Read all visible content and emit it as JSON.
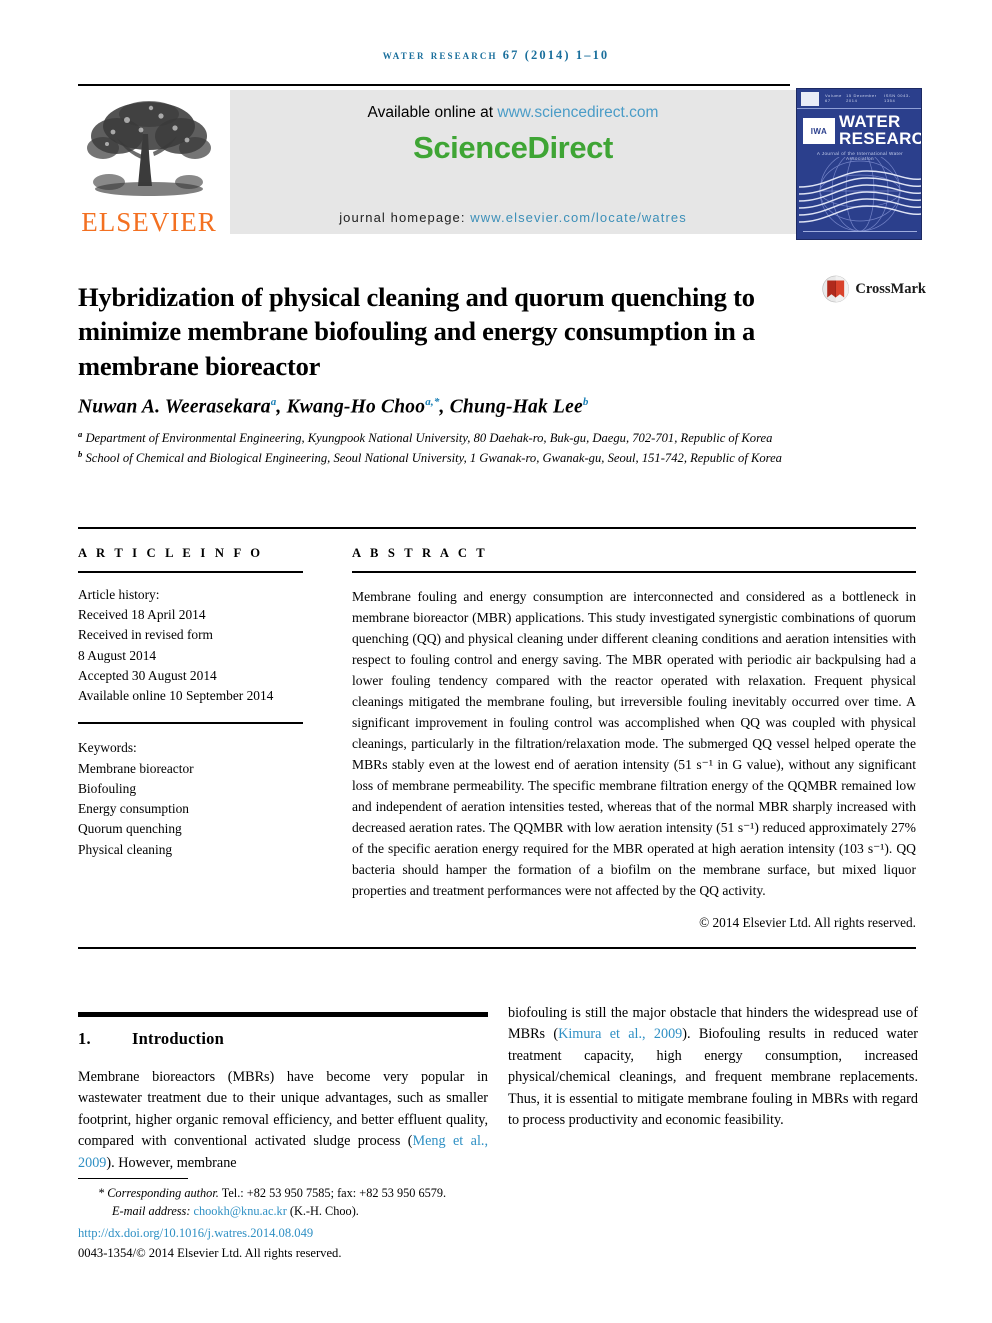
{
  "running_head": "water research 67 (2014) 1–10",
  "masthead": {
    "publisher_name": "ELSEVIER",
    "available_text": "Available online at ",
    "sciencedirect_url": "www.sciencedirect.com",
    "brand": "ScienceDirect",
    "homepage_label": "journal homepage: ",
    "homepage_url": "www.elsevier.com/locate/watres",
    "cover": {
      "volume": "Volume 67",
      "date": "15 December 2014",
      "issn": "ISSN 0043-1354",
      "society": "IWA",
      "title_line1": "WATER",
      "title_line2": "RESEARCH",
      "subtitle": "A Journal of the International Water Association"
    }
  },
  "crossmark": {
    "label": "CrossMark"
  },
  "article": {
    "title": "Hybridization of physical cleaning and quorum quenching to minimize membrane biofouling and energy consumption in a membrane bioreactor",
    "authors": [
      {
        "name": "Nuwan A. Weerasekara",
        "marks": "a"
      },
      {
        "name": "Kwang-Ho Choo",
        "marks": "a,*"
      },
      {
        "name": "Chung-Hak Lee",
        "marks": "b"
      }
    ],
    "affiliations": [
      {
        "mark": "a",
        "text": "Department of Environmental Engineering, Kyungpook National University, 80 Daehak-ro, Buk-gu, Daegu, 702-701, Republic of Korea"
      },
      {
        "mark": "b",
        "text": "School of Chemical and Biological Engineering, Seoul National University, 1 Gwanak-ro, Gwanak-gu, Seoul, 151-742, Republic of Korea"
      }
    ]
  },
  "article_info": {
    "heading": "A R T I C L E  I N F O",
    "history_label": "Article history:",
    "history": [
      "Received 18 April 2014",
      "Received in revised form",
      "8 August 2014",
      "Accepted 30 August 2014",
      "Available online 10 September 2014"
    ],
    "keywords_label": "Keywords:",
    "keywords": [
      "Membrane bioreactor",
      "Biofouling",
      "Energy consumption",
      "Quorum quenching",
      "Physical cleaning"
    ]
  },
  "abstract": {
    "heading": "A B S T R A C T",
    "text": "Membrane fouling and energy consumption are interconnected and considered as a bottleneck in membrane bioreactor (MBR) applications. This study investigated synergistic combinations of quorum quenching (QQ) and physical cleaning under different cleaning conditions and aeration intensities with respect to fouling control and energy saving. The MBR operated with periodic air backpulsing had a lower fouling tendency compared with the reactor operated with relaxation. Frequent physical cleanings mitigated the membrane fouling, but irreversible fouling inevitably occurred over time. A significant improvement in fouling control was accomplished when QQ was coupled with physical cleanings, particularly in the filtration/relaxation mode. The submerged QQ vessel helped operate the MBRs stably even at the lowest end of aeration intensity (51 s⁻¹ in G value), without any significant loss of membrane permeability. The specific membrane filtration energy of the QQMBR remained low and independent of aeration intensities tested, whereas that of the normal MBR sharply increased with decreased aeration rates. The QQMBR with low aeration intensity (51 s⁻¹) reduced approximately 27% of the specific aeration energy required for the MBR operated at high aeration intensity (103 s⁻¹). QQ bacteria should hamper the formation of a biofilm on the membrane surface, but mixed liquor properties and treatment performances were not affected by the QQ activity.",
    "copyright": "© 2014 Elsevier Ltd. All rights reserved."
  },
  "body": {
    "section_number": "1.",
    "section_title": "Introduction",
    "left_paragraph_part1": "Membrane bioreactors (MBRs) have become very popular in wastewater treatment due to their unique advantages, such as smaller footprint, higher organic removal efficiency, and better effluent quality, compared with conventional activated sludge process (",
    "left_citation": "Meng et al., 2009",
    "left_paragraph_part2": "). However, membrane",
    "right_paragraph_part1": "biofouling is still the major obstacle that hinders the widespread use of MBRs (",
    "right_citation": "Kimura et al., 2009",
    "right_paragraph_part2": "). Biofouling results in reduced water treatment capacity, high energy consumption, increased physical/chemical cleanings, and frequent membrane replacements. Thus, it is essential to mitigate membrane fouling in MBRs with regard to process productivity and economic feasibility."
  },
  "footnote": {
    "corresponding_prefix": "* ",
    "corresponding_label": "Corresponding author.",
    "contact": " Tel.: +82 53 950 7585; fax: +82 53 950 6579.",
    "email_label": "E-mail address: ",
    "email": "chookh@knu.ac.kr",
    "email_suffix": " (K.-H. Choo).",
    "doi": "http://dx.doi.org/10.1016/j.watres.2014.08.049",
    "issn_line": "0043-1354/© 2014 Elsevier Ltd. All rights reserved."
  },
  "colors": {
    "accent_blue": "#2f90c4",
    "running_head_blue": "#1a6f9c",
    "sciencedirect_green": "#3fa535",
    "elsevier_orange": "#f37021",
    "cover_navy": "#2b3f8c",
    "crossmark_red": "#c0392b"
  }
}
